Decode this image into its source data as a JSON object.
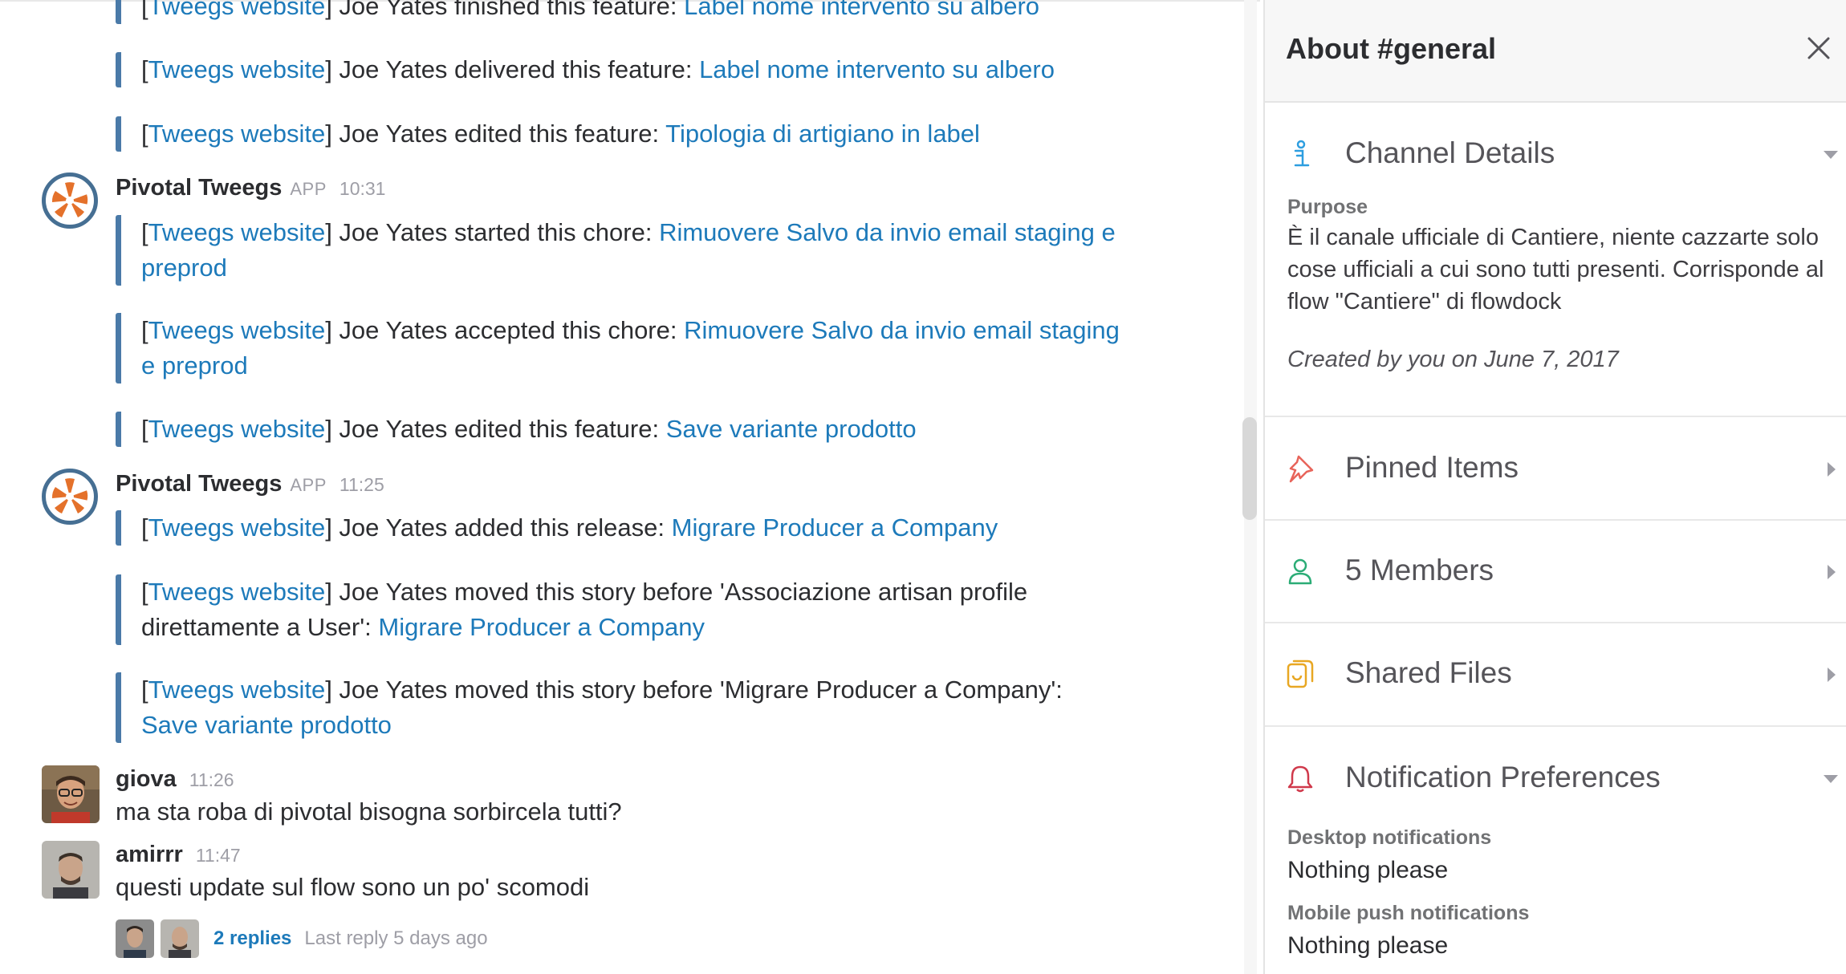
{
  "messages": {
    "top_attachments": [
      {
        "bracket_link": "Tweegs website",
        "text": " Joe Yates finished this feature: ",
        "link": "Label nome intervento su albero"
      },
      {
        "bracket_link": "Tweegs website",
        "text": " Joe Yates delivered this feature: ",
        "link": "Label nome intervento su albero"
      },
      {
        "bracket_link": "Tweegs website",
        "text": " Joe Yates edited this feature: ",
        "link": "Tipologia di artigiano in label"
      }
    ],
    "group1": {
      "sender": "Pivotal Tweegs",
      "badge": "APP",
      "time": "10:31",
      "attachments": [
        {
          "bracket_link": "Tweegs website",
          "line1": " Joe Yates started this chore: ",
          "link1": "Rimuovere Salvo da invio email staging e",
          "link2": "preprod"
        },
        {
          "bracket_link": "Tweegs website",
          "line1": " Joe Yates accepted this chore: ",
          "link1": "Rimuovere Salvo da invio email staging",
          "link2": "e preprod"
        },
        {
          "bracket_link": "Tweegs website",
          "text": " Joe Yates edited this feature: ",
          "link": "Save variante prodotto"
        }
      ]
    },
    "group2": {
      "sender": "Pivotal Tweegs",
      "badge": "APP",
      "time": "11:25",
      "attachments": [
        {
          "bracket_link": "Tweegs website",
          "text": " Joe Yates added this release: ",
          "link": "Migrare Producer a Company"
        },
        {
          "bracket_link": "Tweegs website",
          "line1": " Joe Yates moved this story before 'Associazione artisan profile",
          "line2": "direttamente a User': ",
          "link": "Migrare Producer a Company"
        },
        {
          "bracket_link": "Tweegs website",
          "line1": " Joe Yates moved this story before 'Migrare Producer a Company':",
          "link": "Save variante prodotto"
        }
      ]
    },
    "giova": {
      "sender": "giova",
      "time": "11:26",
      "text": "ma sta roba di pivotal bisogna sorbircela tutti?"
    },
    "amirrr": {
      "sender": "amirrr",
      "time": "11:47",
      "text": "questi update sul flow sono un po' scomodi"
    },
    "thread": {
      "replies": "2 replies",
      "last_reply": "Last reply 5 days ago"
    }
  },
  "sidebar": {
    "title": "About #general",
    "channel_details": {
      "label": "Channel Details",
      "purpose_label": "Purpose",
      "purpose_text": "È il canale ufficiale di Cantiere, niente cazzarte solo cose ufficiali a cui sono tutti presenti. Corrisponde al flow \"Cantiere\" di flowdock",
      "created": "Created by you on June 7, 2017"
    },
    "pinned": {
      "label": "Pinned Items"
    },
    "members": {
      "label": "5 Members"
    },
    "files": {
      "label": "Shared Files"
    },
    "notifications": {
      "label": "Notification Preferences",
      "desktop_label": "Desktop notifications",
      "desktop_value": "Nothing please",
      "mobile_label": "Mobile push notifications",
      "mobile_value": "Nothing please"
    }
  },
  "colors": {
    "link": "#1d7aba",
    "attachment_bar": "#4a7aa8",
    "pivotal_orange": "#e4712b",
    "pivotal_ring": "#466f93"
  },
  "icons": {
    "channel_details": "info-icon",
    "pinned": "pin-icon",
    "members": "person-icon",
    "files": "files-icon",
    "notifications": "bell-icon",
    "close": "close-icon"
  }
}
